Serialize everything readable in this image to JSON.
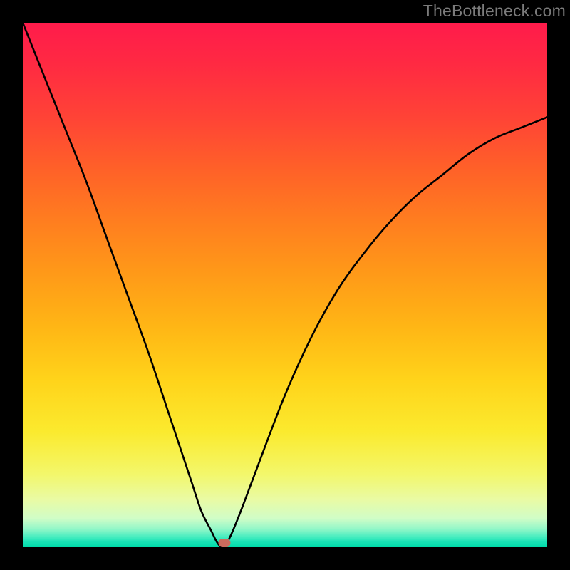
{
  "watermark": "TheBottleneck.com",
  "chart_data": {
    "type": "line",
    "title": "",
    "xlabel": "",
    "ylabel": "",
    "xlim": [
      0,
      100
    ],
    "ylim": [
      0,
      100
    ],
    "grid": false,
    "legend": false,
    "gradient_stops": [
      {
        "pos": 0,
        "color": "#ff1b4b"
      },
      {
        "pos": 50,
        "color": "#ffb014"
      },
      {
        "pos": 80,
        "color": "#f8f248"
      },
      {
        "pos": 100,
        "color": "#00dba9"
      }
    ],
    "series": [
      {
        "name": "bottleneck-curve",
        "x": [
          0,
          4,
          8,
          12,
          16,
          20,
          24,
          28,
          32,
          34,
          36,
          37,
          38,
          39,
          40,
          42,
          45,
          50,
          55,
          60,
          65,
          70,
          75,
          80,
          85,
          90,
          95,
          100
        ],
        "y": [
          100,
          90,
          80,
          70,
          59,
          48,
          37,
          25,
          13,
          7,
          3,
          1,
          0,
          1,
          3,
          8,
          16,
          29,
          40,
          49,
          56,
          62,
          67,
          71,
          75,
          78,
          80,
          82
        ]
      }
    ],
    "marker": {
      "x": 38.5,
      "y": 0.8,
      "color": "#cb6b5d"
    }
  }
}
